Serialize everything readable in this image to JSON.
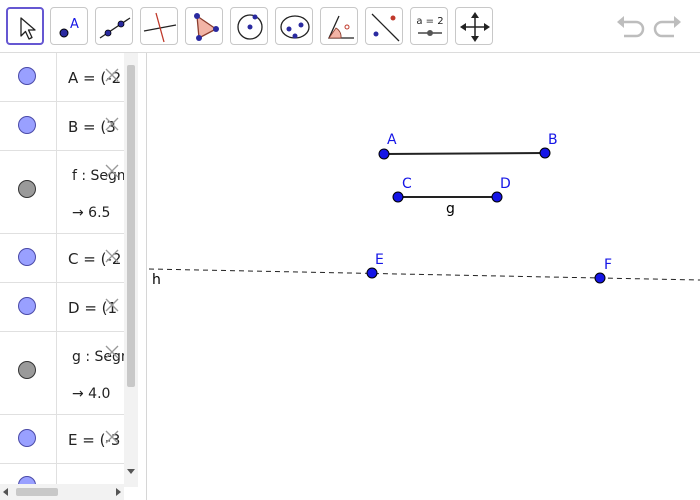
{
  "toolbar": {
    "tools": [
      {
        "name": "move-tool",
        "active": true
      },
      {
        "name": "point-tool",
        "label": "A"
      },
      {
        "name": "line-tool"
      },
      {
        "name": "perpendicular-line-tool"
      },
      {
        "name": "polygon-tool"
      },
      {
        "name": "circle-center-point-tool"
      },
      {
        "name": "ellipse-tool"
      },
      {
        "name": "angle-tool"
      },
      {
        "name": "reflect-about-line-tool"
      },
      {
        "name": "slider-tool",
        "label": "a = 2"
      },
      {
        "name": "move-graphics-view-tool"
      }
    ],
    "undo_icon": "undo-icon",
    "redo_icon": "redo-icon"
  },
  "algebra": {
    "rows": [
      {
        "marble": "blue",
        "text": "A = (-2"
      },
      {
        "marble": "blue",
        "text": "B = (3"
      },
      {
        "marble": "grey",
        "text": "f : Segm",
        "output": "→  6.5"
      },
      {
        "marble": "blue",
        "text": "C = (-2"
      },
      {
        "marble": "blue",
        "text": "D = (1"
      },
      {
        "marble": "grey",
        "text": "g : Segm",
        "output": "→  4.0"
      },
      {
        "marble": "blue",
        "text": "E = (-3"
      }
    ]
  },
  "canvas": {
    "labels": {
      "A": "A",
      "B": "B",
      "C": "C",
      "D": "D",
      "E": "E",
      "F": "F",
      "g": "g",
      "h": "h"
    },
    "colors": {
      "point": "#1515e6",
      "point_stroke": "#000000",
      "label": "#1515e6",
      "line": "#000000"
    }
  }
}
